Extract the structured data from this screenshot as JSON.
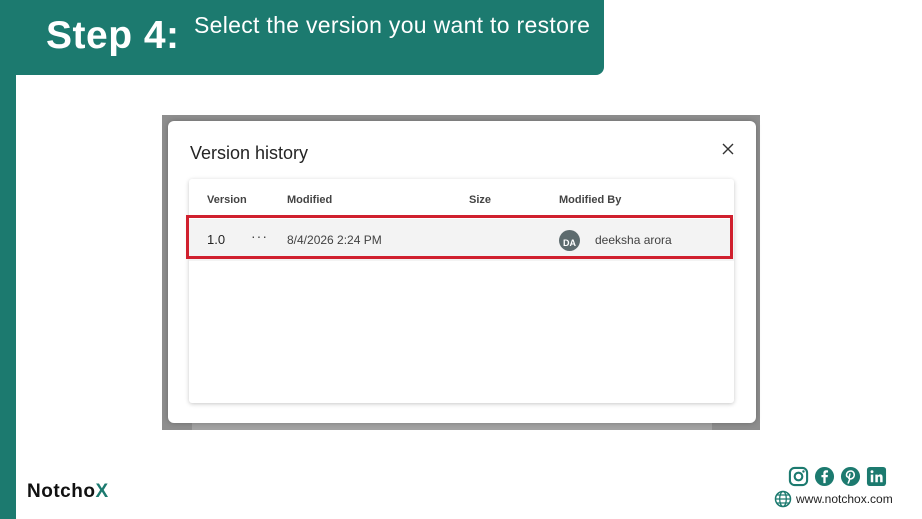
{
  "step": {
    "label": "Step 4:",
    "description": "Select the version you want to restore"
  },
  "dialog": {
    "title": "Version history",
    "columns": {
      "version": "Version",
      "modified": "Modified",
      "size": "Size",
      "modified_by": "Modified By"
    },
    "rows": [
      {
        "version": "1.0",
        "more": "···",
        "modified": "8/4/2026 2:24 PM",
        "size": "",
        "avatar_initials": "DA",
        "modified_by": "deeksha arora"
      }
    ]
  },
  "footer": {
    "brand_prefix": "Notch",
    "brand_o": "o",
    "brand_x": "X",
    "website": "www.notchox.com",
    "social_icons": [
      "instagram-icon",
      "facebook-icon",
      "pinterest-icon",
      "linkedin-icon"
    ]
  },
  "colors": {
    "brand_teal": "#1c7a6f",
    "highlight_red": "#d0202e"
  }
}
